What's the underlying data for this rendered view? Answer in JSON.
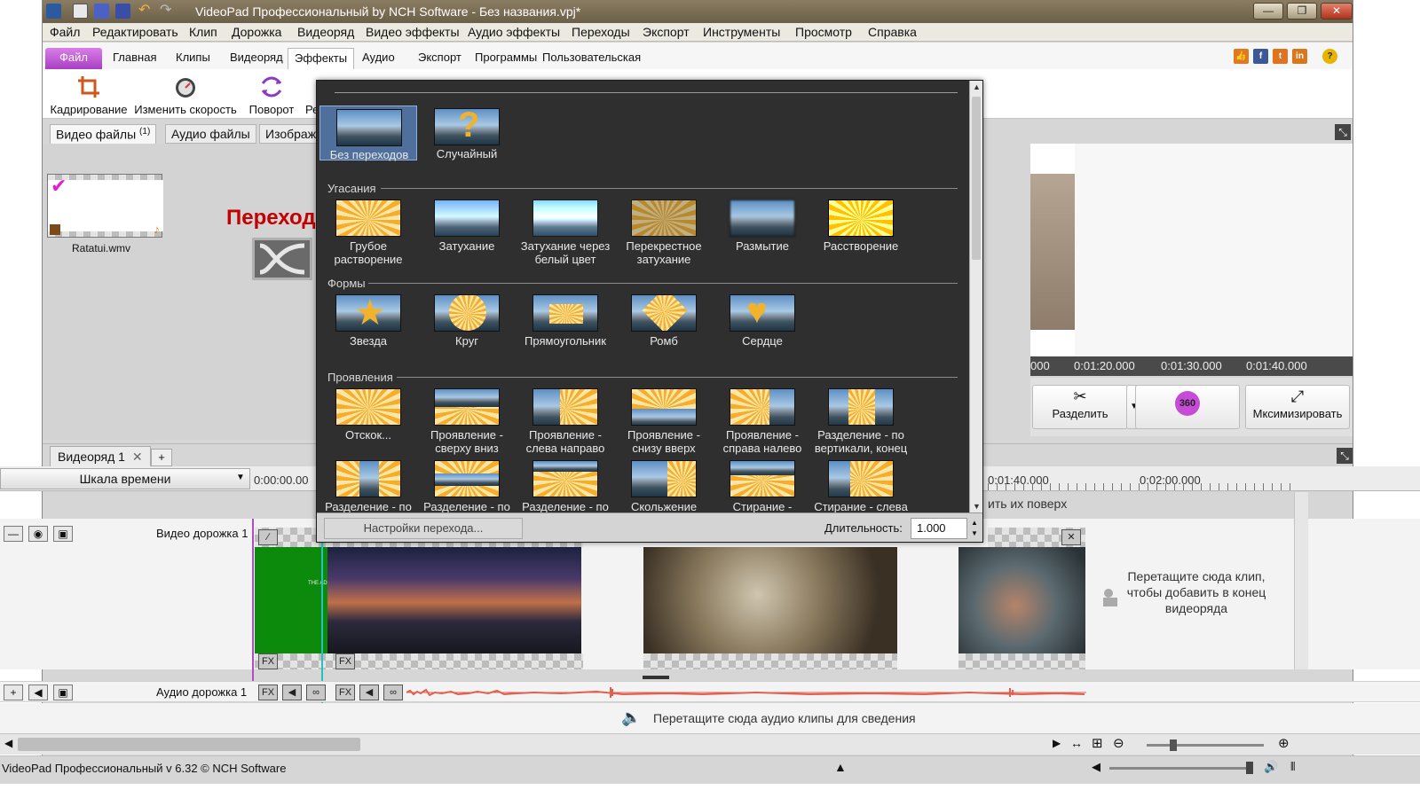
{
  "window": {
    "title": "VideoPad Профессиональный by NCH Software - Без названия.vpj*",
    "minimize": "—",
    "restore": "❐",
    "close": "✕"
  },
  "menu": [
    "Файл",
    "Редактировать",
    "Клип",
    "Дорожка",
    "Видеоряд",
    "Видео эффекты",
    "Аудио эффекты",
    "Переходы",
    "Экспорт",
    "Инструменты",
    "Просмотр",
    "Справка"
  ],
  "ribbon_tabs": [
    "Файл",
    "Главная",
    "Клипы",
    "Видеоряд",
    "Эффекты",
    "Аудио",
    "Экспорт",
    "Программы",
    "Пользовательская"
  ],
  "social": {
    "facebook": "f",
    "twitter": "t",
    "linkedin": "in",
    "help": "?"
  },
  "toolbar": [
    "Кадрирование",
    "Изменить скорость",
    "Поворот",
    "Регулиро"
  ],
  "bin": {
    "tabs": [
      "Видео файлы",
      "Аудио файлы",
      "Изображения"
    ],
    "video_count": "(1)",
    "clip_name": "Ratatui.wmv",
    "annotation": "Переходи"
  },
  "transitions": {
    "top": [
      "Без переходов",
      "Случайный"
    ],
    "sections": [
      {
        "name": "Угасания",
        "items": [
          "Грубое растворение",
          "Затухание",
          "Затухание через белый цвет",
          "Перекрестное затухание",
          "Размытие",
          "Расстворение"
        ]
      },
      {
        "name": "Формы",
        "items": [
          "Звезда",
          "Круг",
          "Прямоугольник",
          "Ромб",
          "Сердце"
        ]
      },
      {
        "name": "Проявления",
        "items": [
          "Отскок...",
          "Проявление - сверху вниз",
          "Проявление - слева направо",
          "Проявление - снизу вверх",
          "Проявление - справа налево",
          "Разделение - по вертикали, конец"
        ]
      },
      {
        "name": "",
        "items": [
          "Разделение - по",
          "Разделение - по",
          "Разделение - по",
          "Скольжение",
          "Стирание -",
          "Стирание - слева"
        ]
      }
    ],
    "settings_button": "Настройки перехода...",
    "duration_label": "Длительность:",
    "duration_value": "1.000"
  },
  "preview": {
    "ruler": [
      "000",
      "0:01:20.000",
      "0:01:30.000",
      "0:01:40.000"
    ],
    "buttons": {
      "split": "Разделить",
      "vr": "360",
      "maximize": "Мксимизировать"
    }
  },
  "sequence": {
    "tab": "Видеоряд 1",
    "close": "✕",
    "add": "+",
    "timeline_mode": "Шкала времени",
    "ruler": [
      "0:00:00.00",
      "0:01:40.000",
      "0:02:00.000"
    ],
    "overlay_hint": "ить их поверх",
    "video_track": "Видео дорожка 1",
    "audio_track": "Аудио дорожка 1",
    "drop_video_hint": "Перетащите сюда клип, чтобы добавить в конец видеоряда",
    "drop_audio_hint": "Перетащите сюда аудио клипы для сведения",
    "fx": "FX",
    "title_card_text": "THE AD"
  },
  "status": {
    "text": "VideoPad Профессиональный v 6.32 © NCH Software"
  },
  "colors": {
    "accent_file_tab": "#b24ac9",
    "annotation_red": "#c40000",
    "waveform": "#e06050",
    "selection": "#4f6f9c"
  }
}
